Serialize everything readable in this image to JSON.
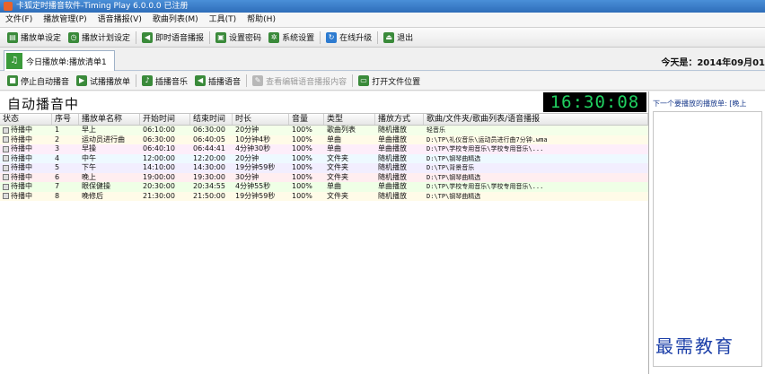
{
  "window": {
    "title": "卡狐定时播音软件-Timing Play 6.0.0.0  已注册"
  },
  "menu": [
    "文件(F)",
    "播放管理(P)",
    "语音播报(V)",
    "歌曲列表(M)",
    "工具(T)",
    "帮助(H)"
  ],
  "toolbar": [
    {
      "label": "播放单设定",
      "icon": "schedule-icon",
      "color": "#3a8a3a"
    },
    {
      "label": "播放计划设定",
      "icon": "clock-icon",
      "color": "#3a8a3a"
    },
    {
      "label": "即时语音播报",
      "icon": "speaker-icon",
      "color": "#3a8a3a"
    },
    {
      "label": "设置密码",
      "icon": "lock-icon",
      "color": "#3a8a3a"
    },
    {
      "label": "系统设置",
      "icon": "gear-icon",
      "color": "#3a8a3a"
    },
    {
      "label": "在线升级",
      "icon": "update-icon",
      "color": "#2d7bd0"
    },
    {
      "label": "退出",
      "icon": "exit-icon",
      "color": "#3a8a3a"
    }
  ],
  "tab": {
    "label": "今日播放单:播放清单1"
  },
  "today_label": "今天是：2014年09月01",
  "toolbar2": [
    {
      "label": "停止自动播音",
      "icon": "stop-icon",
      "disabled": false
    },
    {
      "label": "试播播放单",
      "icon": "play-icon",
      "disabled": false
    },
    {
      "label": "插播音乐",
      "icon": "music-icon",
      "disabled": false
    },
    {
      "label": "插播语音",
      "icon": "voice-icon",
      "disabled": false
    },
    {
      "label": "查看编辑语音播报内容",
      "icon": "edit-icon",
      "disabled": true
    },
    {
      "label": "打开文件位置",
      "icon": "folder-icon",
      "disabled": false
    }
  ],
  "status": {
    "text": "自动播音中",
    "clock": "16:30:08"
  },
  "right_pane": {
    "title": "下一个要播放的播放单: [晚上"
  },
  "watermark": "最需教育",
  "table": {
    "columns": [
      "状态",
      "序号",
      "播放单名称",
      "开始时间",
      "结束时间",
      "时长",
      "音量",
      "类型",
      "播放方式",
      "歌曲/文件夹/歌曲列表/语音播报"
    ],
    "rows": [
      {
        "status": "待播中",
        "no": "1",
        "name": "早上",
        "start": "06:10:00",
        "end": "06:30:00",
        "dur": "20分钟",
        "vol": "100%",
        "type": "歌曲列表",
        "mode": "随机播放",
        "src": "轻音乐",
        "bg": "#f4ffe9"
      },
      {
        "status": "待播中",
        "no": "2",
        "name": "运动员进行曲",
        "start": "06:30:00",
        "end": "06:40:05",
        "dur": "10分钟4秒",
        "vol": "100%",
        "type": "单曲",
        "mode": "单曲播放",
        "src": "D:\\TP\\礼仪音乐\\运动员进行曲7分钟.wma",
        "bg": "#fffbe8"
      },
      {
        "status": "待播中",
        "no": "3",
        "name": "早操",
        "start": "06:40:10",
        "end": "06:44:41",
        "dur": "4分钟30秒",
        "vol": "100%",
        "type": "单曲",
        "mode": "单曲播放",
        "src": "D:\\TP\\学校专用音乐\\学校专用音乐\\...",
        "bg": "#fdeefa"
      },
      {
        "status": "待播中",
        "no": "4",
        "name": "中午",
        "start": "12:00:00",
        "end": "12:20:00",
        "dur": "20分钟",
        "vol": "100%",
        "type": "文件夹",
        "mode": "随机播放",
        "src": "D:\\TP\\钢琴曲精选",
        "bg": "#eef9ff"
      },
      {
        "status": "待播中",
        "no": "5",
        "name": "下午",
        "start": "14:10:00",
        "end": "14:30:00",
        "dur": "19分钟59秒",
        "vol": "100%",
        "type": "文件夹",
        "mode": "随机播放",
        "src": "D:\\TP\\背景音乐",
        "bg": "#f2eefe"
      },
      {
        "status": "待播中",
        "no": "6",
        "name": "晚上",
        "start": "19:00:00",
        "end": "19:30:00",
        "dur": "30分钟",
        "vol": "100%",
        "type": "文件夹",
        "mode": "随机播放",
        "src": "D:\\TP\\钢琴曲精选",
        "bg": "#ffeef0"
      },
      {
        "status": "待播中",
        "no": "7",
        "name": "眼保健操",
        "start": "20:30:00",
        "end": "20:34:55",
        "dur": "4分钟55秒",
        "vol": "100%",
        "type": "单曲",
        "mode": "单曲播放",
        "src": "D:\\TP\\学校专用音乐\\学校专用音乐\\...",
        "bg": "#efffe6"
      },
      {
        "status": "待播中",
        "no": "8",
        "name": "晚修后",
        "start": "21:30:00",
        "end": "21:50:00",
        "dur": "19分钟59秒",
        "vol": "100%",
        "type": "文件夹",
        "mode": "随机播放",
        "src": "D:\\TP\\钢琴曲精选",
        "bg": "#fffbe8"
      }
    ]
  }
}
